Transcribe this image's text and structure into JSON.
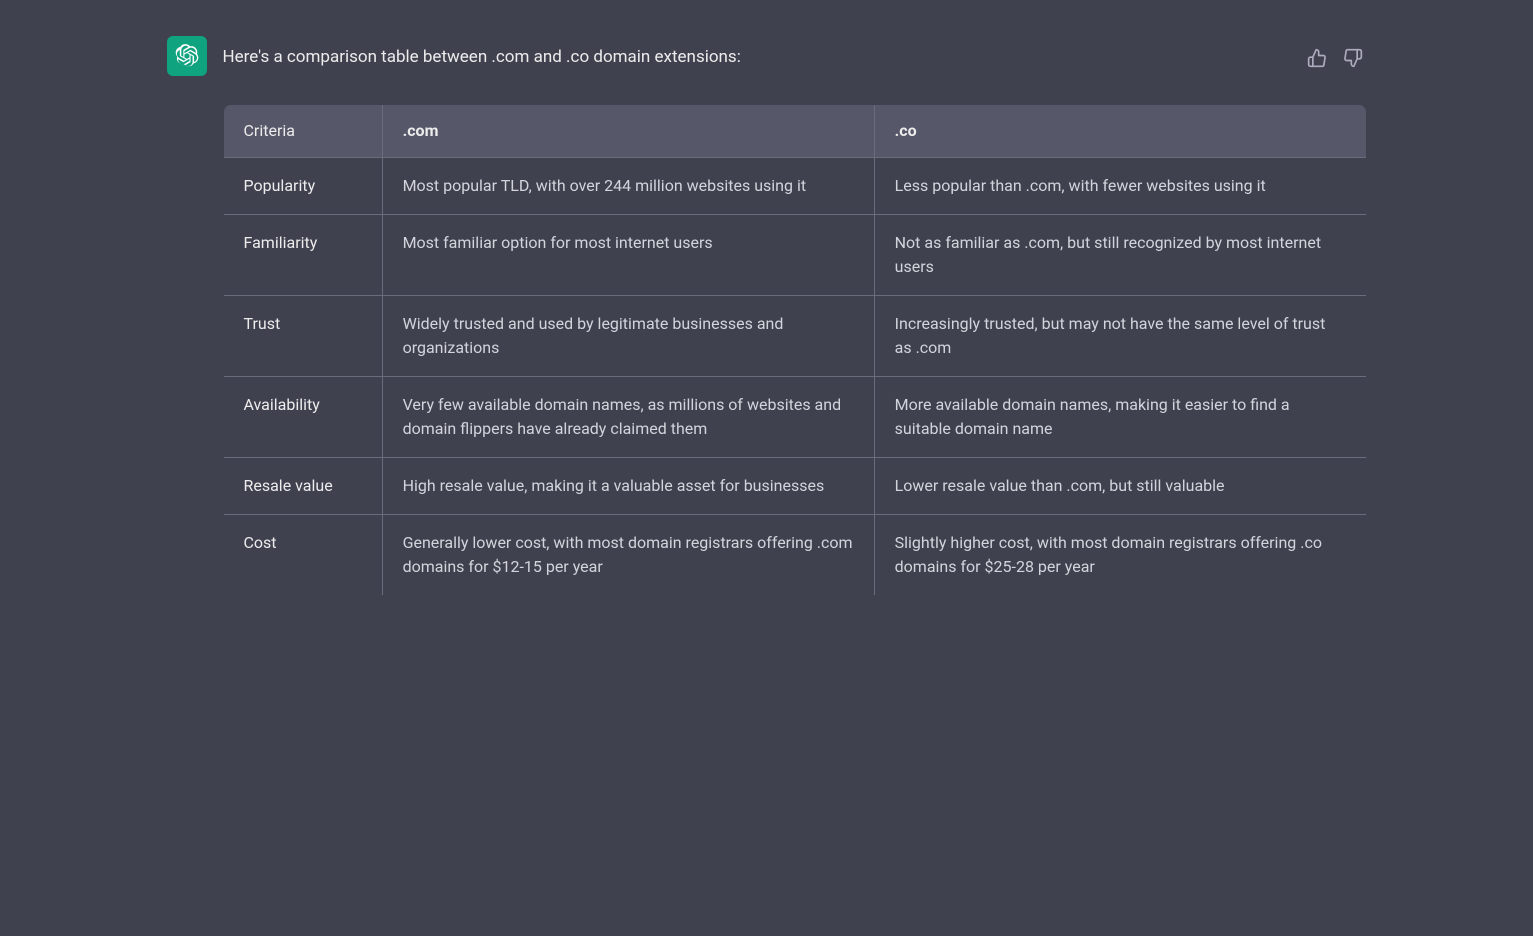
{
  "header": {
    "message": "Here's a comparison table between .com and .co domain extensions:",
    "avatar_label": "ChatGPT logo"
  },
  "feedback": {
    "thumbs_up_label": "thumbs up",
    "thumbs_down_label": "thumbs down"
  },
  "table": {
    "columns": [
      {
        "key": "criteria",
        "label": "Criteria"
      },
      {
        "key": "com",
        "label": ".com"
      },
      {
        "key": "co",
        "label": ".co"
      }
    ],
    "rows": [
      {
        "criteria": "Popularity",
        "com": "Most popular TLD, with over 244 million websites using it",
        "co": "Less popular than .com, with fewer websites using it"
      },
      {
        "criteria": "Familiarity",
        "com": "Most familiar option for most internet users",
        "co": "Not as familiar as .com, but still recognized by most internet users"
      },
      {
        "criteria": "Trust",
        "com": "Widely trusted and used by legitimate businesses and organizations",
        "co": "Increasingly trusted, but may not have the same level of trust as .com"
      },
      {
        "criteria": "Availability",
        "com": "Very few available domain names, as millions of websites and domain flippers have already claimed them",
        "co": "More available domain names, making it easier to find a suitable domain name"
      },
      {
        "criteria": "Resale value",
        "com": "High resale value, making it a valuable asset for businesses",
        "co": "Lower resale value than .com, but still valuable"
      },
      {
        "criteria": "Cost",
        "com": "Generally lower cost, with most domain registrars offering .com domains for $12-15 per year",
        "co": "Slightly higher cost, with most domain registrars offering .co domains for $25-28 per year"
      }
    ]
  }
}
